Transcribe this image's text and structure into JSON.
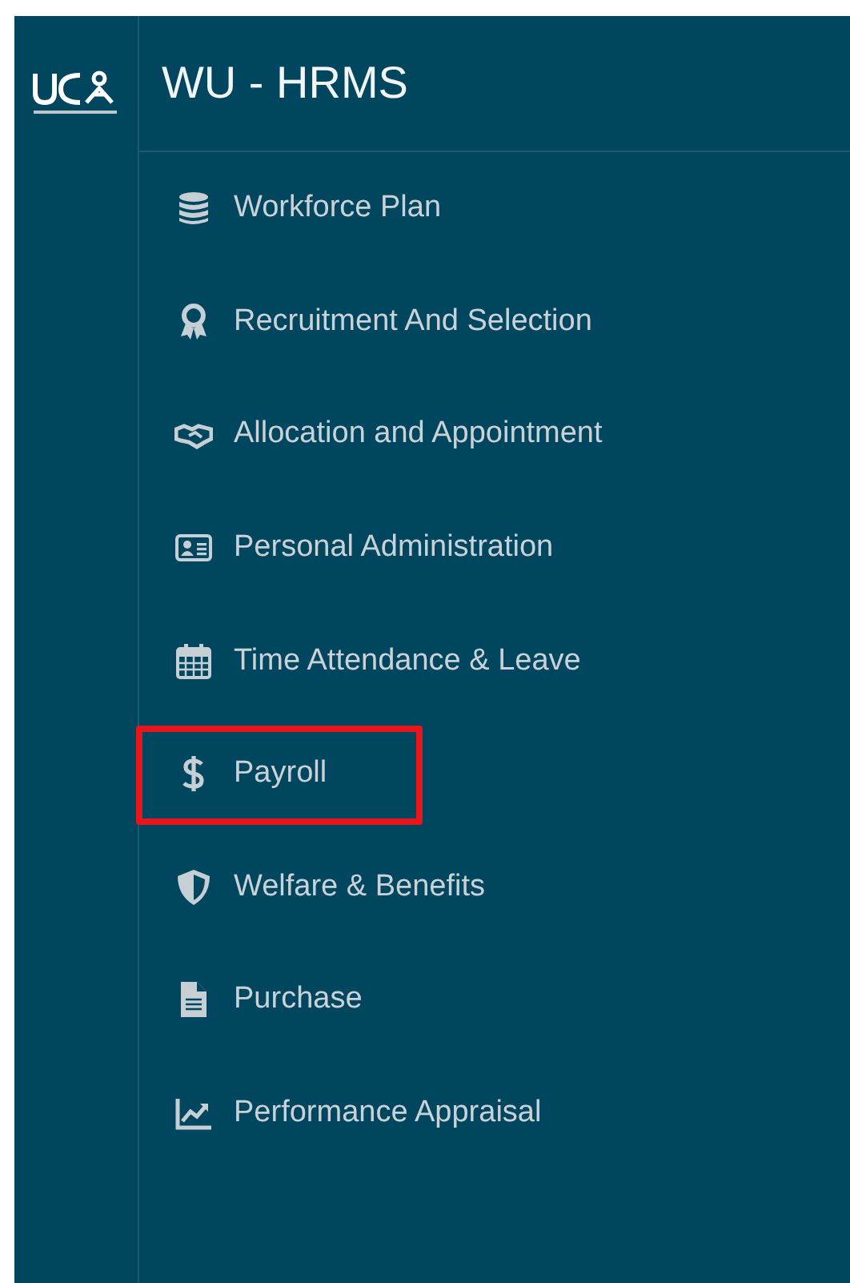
{
  "header": {
    "title": "WU - HRMS"
  },
  "menu": [
    {
      "label": "Workforce Plan",
      "highlighted": false
    },
    {
      "label": "Recruitment And Selection",
      "highlighted": false
    },
    {
      "label": "Allocation and Appointment",
      "highlighted": false
    },
    {
      "label": "Personal Administration",
      "highlighted": false
    },
    {
      "label": "Time Attendance & Leave",
      "highlighted": false
    },
    {
      "label": "Payroll",
      "highlighted": true
    },
    {
      "label": "Welfare & Benefits",
      "highlighted": false
    },
    {
      "label": "Purchase",
      "highlighted": false
    },
    {
      "label": "Performance Appraisal",
      "highlighted": false
    }
  ]
}
